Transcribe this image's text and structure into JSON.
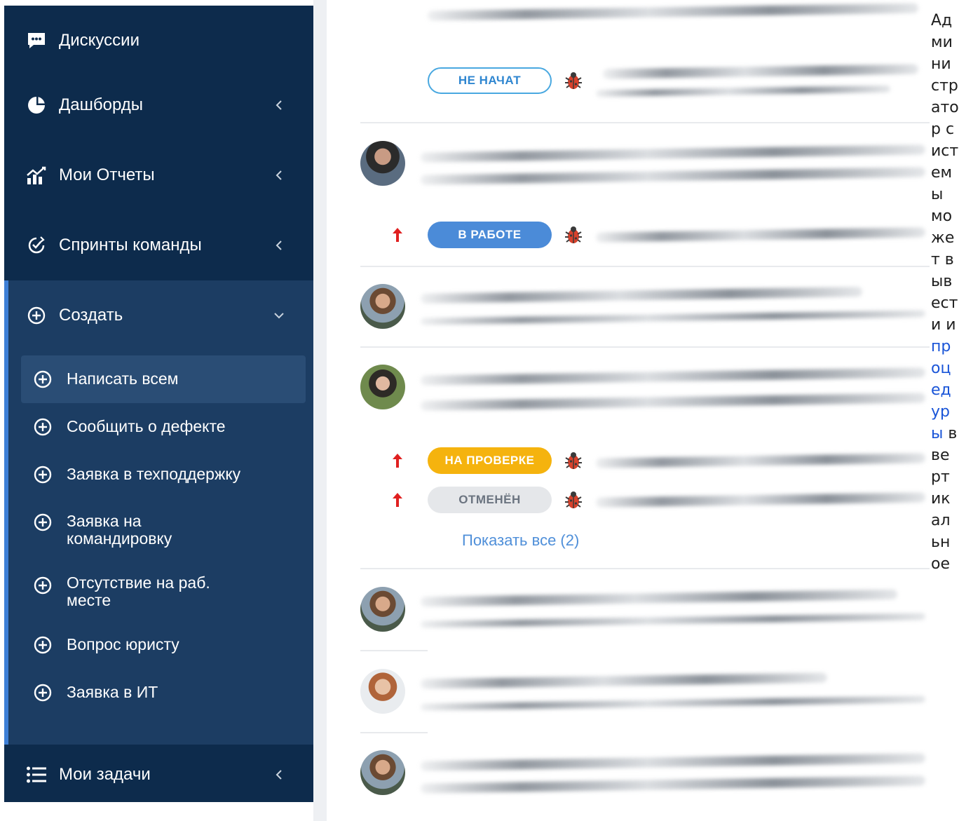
{
  "sidebar": {
    "discussions": "Дискуссии",
    "dashboards": "Дашборды",
    "my_reports": "Мои Отчеты",
    "team_sprints": "Спринты команды",
    "create": "Создать",
    "create_items": [
      {
        "label": "Написать всем"
      },
      {
        "label": "Сообщить о дефекте"
      },
      {
        "label": "Заявка в техподдержку"
      },
      {
        "label": "Заявка на командировку"
      },
      {
        "label": "Отсутствие на раб. месте"
      },
      {
        "label": "Вопрос юристу"
      },
      {
        "label": "Заявка в ИТ"
      }
    ],
    "my_tasks": "Мои задачи"
  },
  "feed": {
    "statuses": {
      "not_started": "НЕ НАЧАТ",
      "in_work": "В РАБОТЕ",
      "on_review": "НА ПРОВЕРКЕ",
      "cancelled": "ОТМЕНЁН"
    },
    "show_all": "Показать все (2)"
  },
  "side_text": {
    "before_link": "Администратор системы может вывести и ",
    "link": "процедуры",
    "after_link": " в вертикальное"
  },
  "colors": {
    "sidebar_bg": "#0d2b4c",
    "submenu_bg": "#1c3d63",
    "accent": "#3d7fd6",
    "pill_in_work": "#4b8bd8",
    "pill_review": "#f5b30e",
    "pill_cancelled": "#e5e7ea",
    "priority_arrow": "#e02020",
    "link": "#1a55d8"
  }
}
